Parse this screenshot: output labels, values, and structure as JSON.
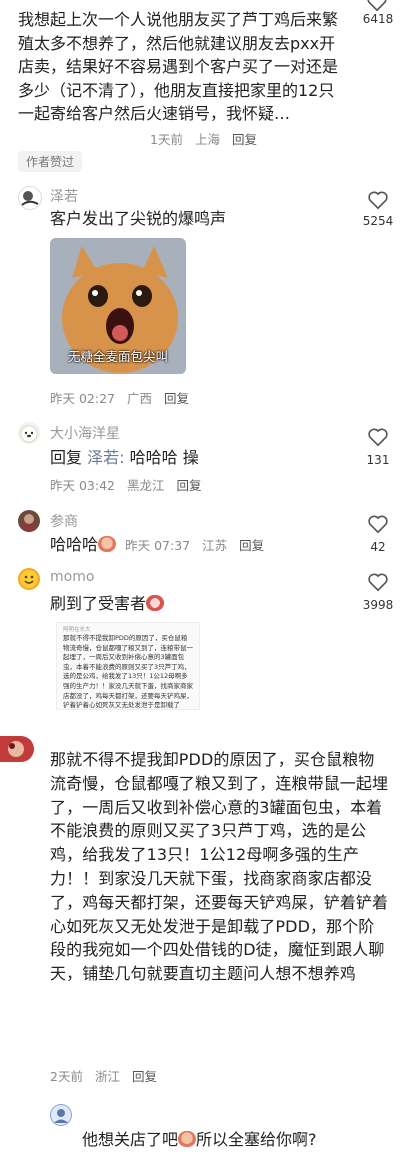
{
  "comments": {
    "c0": {
      "text": "我想起上次一个人说他朋友买了芦丁鸡后来繁殖太多不想养了，然后他就建议朋友去pxx开店卖，结果好不容易遇到个客户买了一对还是多少（记不清了），他朋友直接把家里的12只一起寄给客户然后火速销号，我怀疑…",
      "time": "1天前",
      "location": "上海",
      "reply_label": "回复",
      "like_count": "6418",
      "author_badge": "作者赞过"
    },
    "c1": {
      "name": "泽若",
      "text": "客户发出了尖锐的爆鸣声",
      "image_caption": "无糖全麦面包尖叫",
      "time": "昨天 02:27",
      "location": "广西",
      "reply_label": "回复",
      "like_count": "5254"
    },
    "c2": {
      "name": "大小海洋星",
      "reply_prefix": "回复",
      "mention": "泽若:",
      "text": "哈哈哈 操",
      "time": "昨天 03:42",
      "location": "黑龙江",
      "reply_label": "回复",
      "like_count": "131"
    },
    "c3": {
      "name": "参商",
      "text": "哈哈哈",
      "time": "昨天 07:37",
      "location": "江苏",
      "reply_label": "回复",
      "like_count": "42"
    },
    "c4": {
      "name": "momo",
      "text": "刷到了受害者",
      "like_count": "3998",
      "thumb_header": "阿明在长大",
      "thumb_text": "那就不得不提我卸PDD的原因了，买仓鼠粮物流奇慢，仓鼠都嘎了粮又到了，连粮带鼠一起埋了，一周后又收到补偿心意的3罐面包虫，本着不能浪费的原则又买了3只芦丁鸡，选的是公鸡，给我发了13只！1公12母啊多强的生产力！！家没几天就下蛋，找商家商家店都没了，鸡每天都打架，还要每天铲鸡屎，铲着铲着心如死灰又无处发泄于是卸载了PDD"
    },
    "c5": {
      "text": "那就不得不提我卸PDD的原因了，买仓鼠粮物流奇慢，仓鼠都嘎了粮又到了，连粮带鼠一起埋了，一周后又收到补偿心意的3罐面包虫，本着不能浪费的原则又买了3只芦丁鸡，选的是公鸡，给我发了13只！1公12母啊多强的生产力！！到家没几天就下蛋，找商家商家店都没了，鸡每天都打架，还要每天铲鸡屎，铲着铲着心如死灰又无处发泄于是卸载了PDD，那个阶段的我宛如一个四处借钱的D徒，魔怔到跟人聊天，铺垫几句就要直切主题问人想不想养鸡",
      "time": "2天前",
      "location": "浙江",
      "reply_label": "回复"
    },
    "c6": {
      "text_a": "他想关店了吧",
      "text_b": "所以全塞给你啊?"
    }
  },
  "icons": {
    "like": "heart-outline-icon",
    "sticker_laugh": "laughing-face-sticker-icon",
    "sticker_cry": "crying-face-sticker-icon"
  },
  "colors": {
    "mention": "#6a7a96",
    "meta": "#8a8a8a",
    "badge_bg": "#f2f2f2"
  }
}
